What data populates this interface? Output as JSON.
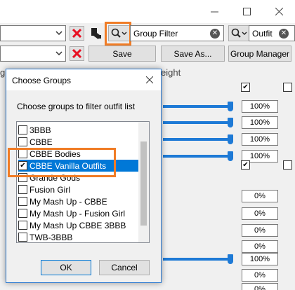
{
  "window": {
    "maximize_glyph": "☐",
    "close_glyph": "✕"
  },
  "toolbar": {
    "save_label": "Save",
    "save_as_label": "Save As...",
    "group_manager_label": "Group Manager",
    "group_filter_placeholder": "Group Filter",
    "outfit_filter_placeholder": "Outfit"
  },
  "background": {
    "left_header_fragment": "g",
    "weight_header_fragment": "eight",
    "percentages": [
      "100%",
      "100%",
      "100%",
      "100%",
      "0%",
      "0%",
      "0%",
      "0%",
      "0%",
      "100%",
      "0%",
      "0%"
    ]
  },
  "dialog": {
    "title": "Choose Groups",
    "prompt": "Choose groups to filter outfit list",
    "groups": [
      {
        "label": "3BBB",
        "checked": false,
        "selected": false
      },
      {
        "label": "CBBE",
        "checked": false,
        "selected": false
      },
      {
        "label": "CBBE Bodies",
        "checked": false,
        "selected": false
      },
      {
        "label": "CBBE Vanilla Outfits",
        "checked": true,
        "selected": true
      },
      {
        "label": "Grande Gods",
        "checked": false,
        "selected": false
      },
      {
        "label": "Fusion Girl",
        "checked": false,
        "selected": false
      },
      {
        "label": "My Mash Up - CBBE",
        "checked": false,
        "selected": false
      },
      {
        "label": "My Mash Up - Fusion Girl",
        "checked": false,
        "selected": false
      },
      {
        "label": "My Mash Up CBBE 3BBB",
        "checked": false,
        "selected": false
      },
      {
        "label": "TWB-3BBB",
        "checked": false,
        "selected": false
      }
    ],
    "ok_label": "OK",
    "cancel_label": "Cancel"
  },
  "colors": {
    "accent": "#0078d7",
    "highlight_box": "#f07c26",
    "error_red": "#e81123"
  }
}
